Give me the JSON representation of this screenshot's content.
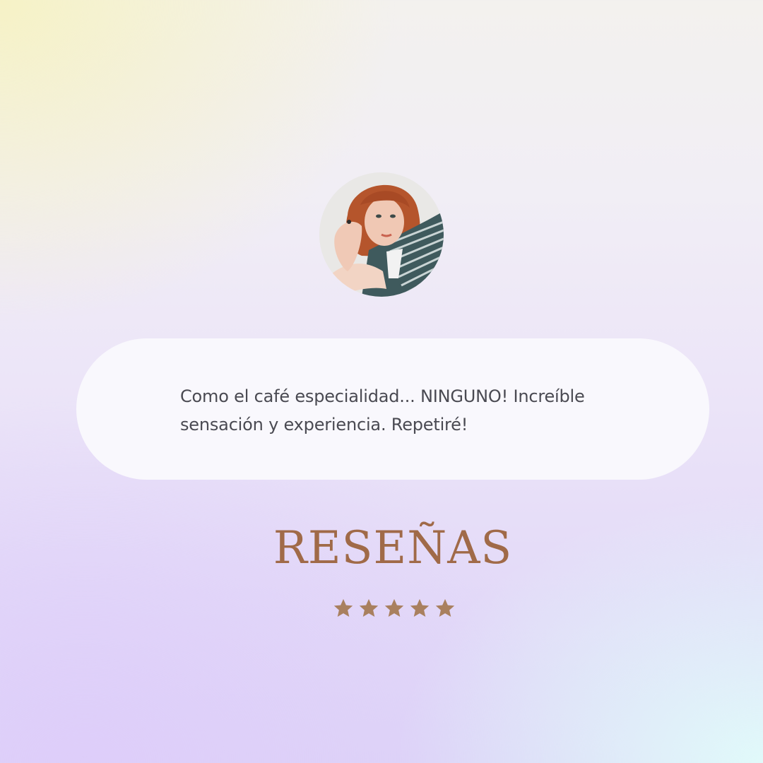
{
  "review": {
    "avatar_icon": "reviewer-photo",
    "quote": "Como el café especialidad... NINGUNO! Increíble sensación y experiencia. Repetiré!"
  },
  "title": "RESEÑAS",
  "rating": {
    "stars": 5,
    "max": 5,
    "icon": "star-icon",
    "color": "#a9805f"
  },
  "colors": {
    "title": "#a06a48",
    "quote_text": "#4a4a52",
    "card": "#faf9fd"
  }
}
